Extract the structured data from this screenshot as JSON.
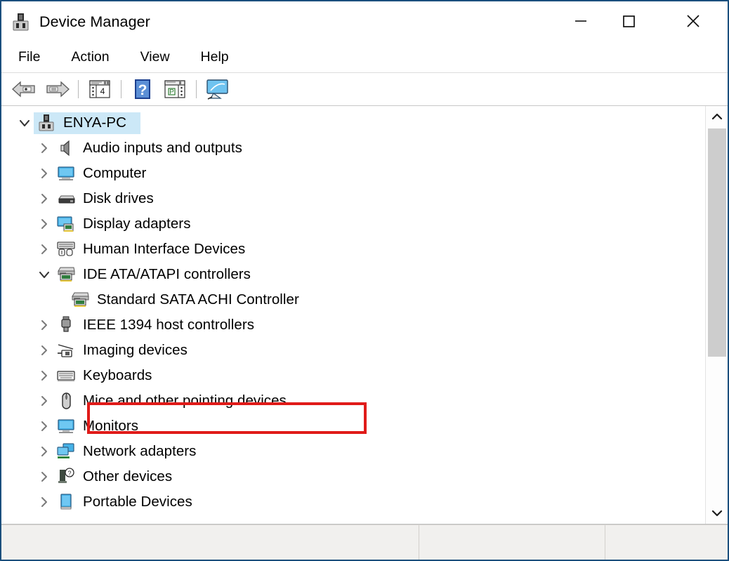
{
  "window": {
    "title": "Device Manager",
    "icon": "device-manager-icon",
    "controls": {
      "minimize": "—",
      "maximize": "□",
      "close": "✕"
    }
  },
  "menubar": {
    "items": [
      {
        "label": "File"
      },
      {
        "label": "Action"
      },
      {
        "label": "View"
      },
      {
        "label": "Help"
      }
    ]
  },
  "toolbar": {
    "items": [
      {
        "name": "back-arrow-icon",
        "title": "Back"
      },
      {
        "name": "forward-arrow-icon",
        "title": "Forward"
      },
      {
        "name": "separator",
        "title": ""
      },
      {
        "name": "properties-icon",
        "title": "Properties"
      },
      {
        "name": "separator",
        "title": ""
      },
      {
        "name": "help-icon",
        "title": "Help"
      },
      {
        "name": "update-driver-icon",
        "title": "Update Driver Software"
      },
      {
        "name": "separator",
        "title": ""
      },
      {
        "name": "scan-hardware-icon",
        "title": "Scan for hardware changes"
      }
    ]
  },
  "tree": {
    "root": {
      "label": "ENYA-PC",
      "icon": "computer-root-icon",
      "expanded": true,
      "selected": true
    },
    "items": [
      {
        "label": "Audio inputs and outputs",
        "icon": "speaker-icon",
        "expanded": false,
        "depth": 1
      },
      {
        "label": "Computer",
        "icon": "computer-icon",
        "expanded": false,
        "depth": 1
      },
      {
        "label": "Disk drives",
        "icon": "disk-drive-icon",
        "expanded": false,
        "depth": 1
      },
      {
        "label": "Display adapters",
        "icon": "display-adapter-icon",
        "expanded": false,
        "depth": 1
      },
      {
        "label": "Human Interface Devices",
        "icon": "hid-icon",
        "expanded": false,
        "depth": 1
      },
      {
        "label": "IDE ATA/ATAPI controllers",
        "icon": "ide-controller-icon",
        "expanded": true,
        "depth": 1
      },
      {
        "label": "Standard SATA ACHI Controller",
        "icon": "sata-controller-icon",
        "expanded": null,
        "depth": 2,
        "highlighted": true
      },
      {
        "label": "IEEE 1394 host controllers",
        "icon": "ieee1394-icon",
        "expanded": false,
        "depth": 1
      },
      {
        "label": "Imaging devices",
        "icon": "scanner-icon",
        "expanded": false,
        "depth": 1
      },
      {
        "label": "Keyboards",
        "icon": "keyboard-icon",
        "expanded": false,
        "depth": 1
      },
      {
        "label": "Mice and other pointing devices",
        "icon": "mouse-icon",
        "expanded": false,
        "depth": 1
      },
      {
        "label": "Monitors",
        "icon": "monitor-icon",
        "expanded": false,
        "depth": 1
      },
      {
        "label": "Network adapters",
        "icon": "network-adapter-icon",
        "expanded": false,
        "depth": 1
      },
      {
        "label": "Other devices",
        "icon": "unknown-device-icon",
        "expanded": false,
        "depth": 1
      },
      {
        "label": "Portable Devices",
        "icon": "portable-device-icon",
        "expanded": false,
        "depth": 1
      }
    ]
  },
  "annotation": {
    "target_label": "Standard SATA ACHI Controller",
    "color": "#e01b19",
    "shape": "rectangle"
  },
  "scrollbar": {
    "up_arrow": "⌃",
    "down_arrow": "⌄",
    "orientation": "vertical"
  },
  "statusbar": {
    "cells": [
      "",
      "",
      ""
    ]
  },
  "colors": {
    "window_border": "#1b4f7d",
    "selection": "#cce8f7",
    "annotation": "#e01b19",
    "statusbar_bg": "#f1f0ee"
  }
}
